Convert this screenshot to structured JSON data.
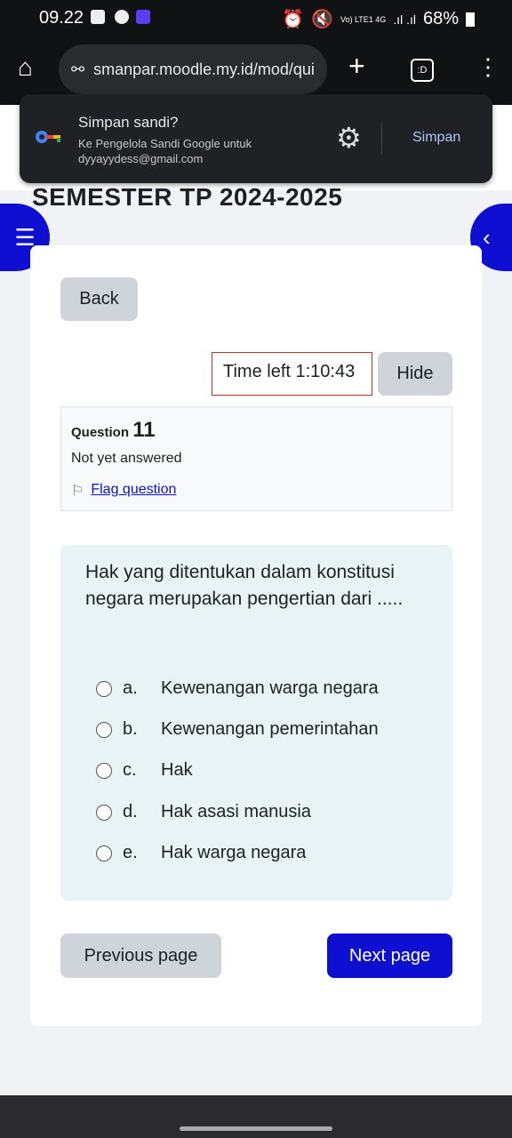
{
  "status_bar": {
    "time": "09.22",
    "signal": "Vo) LTE1 4G",
    "battery": "68%"
  },
  "browser": {
    "url": "smanpar.moodle.my.id/mod/qui",
    "tabs_label": ":D"
  },
  "password_prompt": {
    "title": "Simpan sandi?",
    "line1": "Ke Pengelola Sandi Google untuk",
    "email": "dyyayydess@gmail.com",
    "save_label": "Simpan"
  },
  "page": {
    "heading": "SEMESTER TP 2024-2025",
    "back_label": "Back",
    "timer": "Time left 1:10:43",
    "hide_label": "Hide"
  },
  "question": {
    "label": "Question",
    "number": "11",
    "status": "Not yet answered",
    "flag_label": "Flag question",
    "text": "Hak yang ditentukan dalam konstitusi negara merupakan pengertian dari .....",
    "options": [
      {
        "letter": "a.",
        "text": "Kewenangan warga negara"
      },
      {
        "letter": "b.",
        "text": "Kewenangan pemerintahan"
      },
      {
        "letter": "c.",
        "text": "Hak"
      },
      {
        "letter": "d.",
        "text": "Hak asasi manusia"
      },
      {
        "letter": "e.",
        "text": "Hak warga negara"
      }
    ]
  },
  "nav": {
    "previous_label": "Previous page",
    "next_label": "Next page"
  },
  "colors": {
    "primary": "#0f0fd2",
    "timer_border": "#ca3120",
    "question_bg": "#e7f3f5"
  }
}
